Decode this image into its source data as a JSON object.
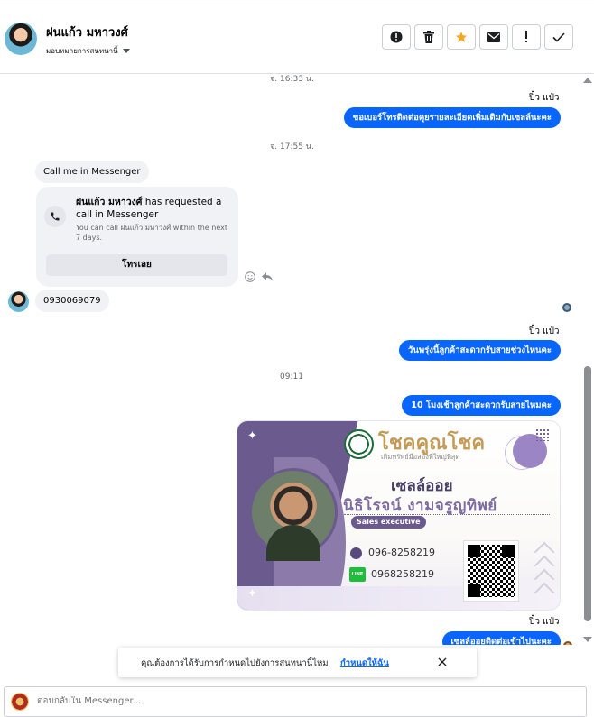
{
  "header": {
    "contact_name": "ฝนแก้ว มหาวงศ์",
    "assign_label": "มอบหมายการสนทนานี้",
    "actions": [
      "report-icon",
      "trash-icon",
      "star-icon",
      "mail-icon",
      "exclamation-icon",
      "check-icon"
    ]
  },
  "colors": {
    "messenger_blue": "#0866ff",
    "star_orange": "#f5a623",
    "card_purple": "#6b5a8e"
  },
  "conversation": {
    "ts1": "จ. 16:33 น.",
    "sender1": "ปิ๋ว แป๋ว",
    "msg1": "ขอเบอร์โทรติดต่อคุยรายละเอียดเพิ่มเติมกับเซลล์นะคะ",
    "ts2": "จ. 17:55 น.",
    "in_msg1": "Call me in Messenger",
    "call_card": {
      "name": "ฝนแก้ว มหาวงศ์",
      "title_rest": " has requested a call in Messenger",
      "subtitle": "You can call ฝนแก้ว มหาวงศ์ within the next 7 days.",
      "button": "โทรเลย"
    },
    "in_msg2": "0930069079",
    "sender2": "ปิ๋ว แป๋ว",
    "msg2": "วันพรุ่งนี้ลูกค้าสะดวกรับสายช่วงไหนคะ",
    "ts3": "09:11",
    "msg3": "10 โมงเช้าลูกค้าสะดวกรับสายไหมคะ",
    "sender3": "ปิ๋ว แป๋ว",
    "msg4": "เซลล์ออยติดต่อเข้าไปนะคะ"
  },
  "business_card": {
    "brand": "โชคคูณโชค",
    "tagline": "เติมทรัพย์มือสองที่ใหญ่ที่สุด",
    "role": "เซลล์ออย",
    "person": "นิธิโรจน์   งามจรูญทิพย์",
    "position": "Sales executive",
    "phone": "096-8258219",
    "line_label": "LINE",
    "line_id": "0968258219"
  },
  "toast": {
    "text": "คุณต้องการได้รับการกำหนดไปยังการสนทนานี้ไหม",
    "link": "กำหนดให้ฉัน"
  },
  "composer": {
    "placeholder": "ตอบกลับใน Messenger..."
  }
}
